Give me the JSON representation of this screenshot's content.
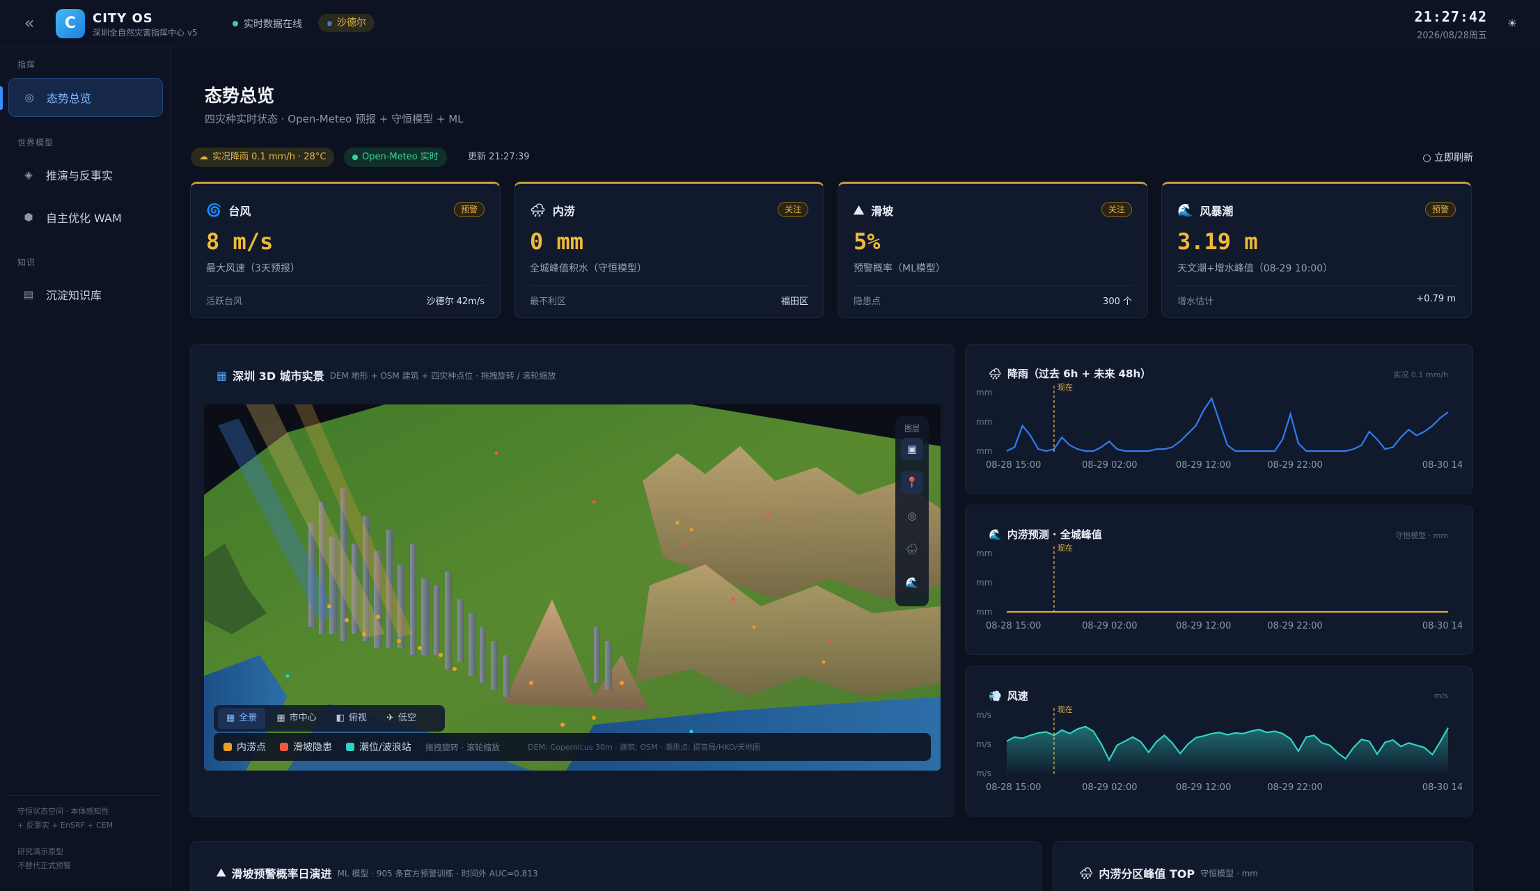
{
  "topbar": {
    "collapse": "«",
    "logo_letter": "C",
    "app_name": "CITY OS",
    "app_sub": "深圳全自然灾害指挥中心 v5",
    "live_status": "实时数据在线",
    "typhoon_chip": "沙德尔",
    "clock": "21:27:42",
    "date": "2026/08/28周五",
    "theme_icon": "☀"
  },
  "sidebar": {
    "section_command": "指挥",
    "section_world": "世界模型",
    "section_knowledge": "知识",
    "items": [
      {
        "label": "态势总览",
        "icon": "◎"
      },
      {
        "label": "推演与反事实",
        "icon": "◈"
      },
      {
        "label": "自主优化 WAM",
        "icon": "⬢"
      },
      {
        "label": "沉淀知识库",
        "icon": "▤"
      }
    ],
    "footer_1": "守恒状态空间 · 本体感知性",
    "footer_2": "+ 反事实 + EnSRF + CEM",
    "footer_3": "研究演示原型",
    "footer_4": "不替代正式预警"
  },
  "header": {
    "title": "态势总览",
    "subtitle": "四灾种实时状态 · Open-Meteo 预报 + 守恒模型 + ML",
    "chip_rain": "实况降雨 0.1 mm/h · 28°C",
    "chip_openmeteo": "Open-Meteo 实时",
    "updated": "更新 21:27:39",
    "refresh": "立即刷新"
  },
  "kpis": [
    {
      "icon": "🌀",
      "title": "台风",
      "badge": "预警",
      "value": "8 m/s",
      "desc": "最大风速（3天预报）",
      "foot_label": "活跃台风",
      "foot_value": "沙德尔 42m/s"
    },
    {
      "icon": "🌧",
      "title": "内涝",
      "badge": "关注",
      "value": "0 mm",
      "desc": "全城峰值积水（守恒模型）",
      "foot_label": "最不利区",
      "foot_value": "福田区"
    },
    {
      "icon": "⛰",
      "title": "滑坡",
      "badge": "关注",
      "value": "5%",
      "desc": "预警概率（ML模型）",
      "foot_label": "隐患点",
      "foot_value": "300 个"
    },
    {
      "icon": "🌊",
      "title": "风暴潮",
      "badge": "预警",
      "value": "3.19 m",
      "desc": "天文潮+增水峰值（08-29 10:00）",
      "foot_label": "增水估计",
      "foot_value": "+0.79 m"
    }
  ],
  "map_panel": {
    "icon": "▦",
    "title": "深圳 3D 城市实景",
    "note": "DEM 地形 + OSM 建筑 + 四灾种点位 · 拖拽旋转 / 滚轮缩放",
    "layer_title": "图层",
    "layers": [
      "▣",
      "📍",
      "◎",
      "🌧",
      "🌊"
    ],
    "views": [
      {
        "icon": "▦",
        "label": "全景"
      },
      {
        "icon": "▦",
        "label": "市中心"
      },
      {
        "icon": "◧",
        "label": "俯视"
      },
      {
        "icon": "✈",
        "label": "低空"
      }
    ],
    "legend": [
      {
        "label": "内涝点",
        "color": "#f0a020"
      },
      {
        "label": "滑坡隐患",
        "color": "#ef5a3c"
      },
      {
        "label": "潮位/波浪站",
        "color": "#2fd3c4"
      }
    ],
    "legend_hint": "拖拽旋转 · 滚轮缩放",
    "credit": "DEM: Copernicus 30m · 建筑: OSM · 潮患点: 提首局/HKO/天地图"
  },
  "charts": {
    "rain": {
      "icon": "🌧",
      "title": "降雨（过去 6h + 未来 48h）",
      "note": "实况 0.1 mm/h",
      "unit": "mm",
      "now": "现在"
    },
    "flood": {
      "icon": "🌊",
      "title": "内涝预测 · 全城峰值",
      "note": "守恒模型 · mm",
      "unit": "mm",
      "now": "现在"
    },
    "wind": {
      "icon": "💨",
      "title": "风速",
      "note": "m/s",
      "unit": "m/s",
      "now": "现在"
    }
  },
  "chart_data": [
    {
      "type": "line",
      "title": "降雨（过去 6h + 未来 48h）",
      "ylabel": "mm",
      "x_ticks": [
        "08-28 15:00",
        "08-29 02:00",
        "08-29 12:00",
        "08-29 22:00",
        "08-30 14:00"
      ],
      "ylim": [
        0,
        3
      ],
      "series": [
        {
          "values": [
            0,
            0.2,
            1.3,
            0.8,
            0.1,
            0,
            0.1,
            0.7,
            0.3,
            0.1,
            0,
            0,
            0.2,
            0.5,
            0.1,
            0,
            0,
            0,
            0,
            0.1,
            0.1,
            0.2,
            0.5,
            0.9,
            1.3,
            2.1,
            2.7,
            1.5,
            0.3,
            0,
            0,
            0,
            0,
            0,
            0,
            0.6,
            1.9,
            0.4,
            0,
            0,
            0,
            0,
            0,
            0,
            0.1,
            0.3,
            1.0,
            0.6,
            0.1,
            0.2,
            0.7,
            1.1,
            0.8,
            1.0,
            1.3,
            1.7,
            2.0
          ]
        }
      ],
      "now_index": 6
    },
    {
      "type": "line",
      "title": "内涝预测 · 全城峰值",
      "ylabel": "mm",
      "x_ticks": [
        "08-28 15:00",
        "08-29 02:00",
        "08-29 12:00",
        "08-29 22:00",
        "08-30 14:00"
      ],
      "ylim": [
        0,
        2
      ],
      "series": [
        {
          "values": [
            0,
            0,
            0,
            0,
            0,
            0,
            0,
            0,
            0,
            0,
            0,
            0,
            0,
            0,
            0,
            0,
            0,
            0,
            0,
            0,
            0,
            0,
            0,
            0,
            0,
            0,
            0,
            0,
            0,
            0,
            0,
            0,
            0,
            0,
            0,
            0,
            0,
            0,
            0,
            0,
            0,
            0,
            0,
            0,
            0,
            0,
            0,
            0,
            0,
            0,
            0,
            0,
            0,
            0,
            0,
            0,
            0
          ]
        }
      ],
      "now_index": 6
    },
    {
      "type": "area",
      "title": "风速",
      "ylabel": "m/s",
      "x_ticks": [
        "08-28 15:00",
        "08-29 02:00",
        "08-29 12:00",
        "08-29 22:00",
        "08-30 14:00"
      ],
      "ylim": [
        0,
        10
      ],
      "series": [
        {
          "values": [
            5.5,
            6.2,
            6.0,
            6.5,
            6.9,
            7.1,
            6.5,
            7.4,
            6.8,
            7.6,
            8.0,
            7.2,
            5.0,
            2.3,
            4.8,
            5.5,
            6.2,
            5.4,
            3.6,
            5.4,
            6.5,
            5.2,
            3.4,
            5.0,
            6.1,
            6.4,
            6.8,
            7.0,
            6.6,
            6.9,
            6.8,
            7.2,
            7.5,
            7.0,
            7.2,
            6.8,
            5.9,
            3.8,
            6.2,
            6.5,
            5.2,
            4.8,
            3.5,
            2.5,
            4.4,
            5.8,
            5.5,
            3.3,
            5.3,
            5.7,
            4.6,
            5.2,
            4.8,
            4.4,
            3.2,
            5.4,
            7.8
          ]
        }
      ],
      "now_index": 6
    }
  ],
  "bottom": {
    "landslide_icon": "⛰",
    "landslide_title": "滑坡预警概率日演进",
    "landslide_note": "ML 模型 · 905 条官方预警训练 · 时间外 AUC=0.813",
    "flood_icon": "🌧",
    "flood_title": "内涝分区峰值 TOP",
    "flood_note": "守恒模型 · mm"
  }
}
